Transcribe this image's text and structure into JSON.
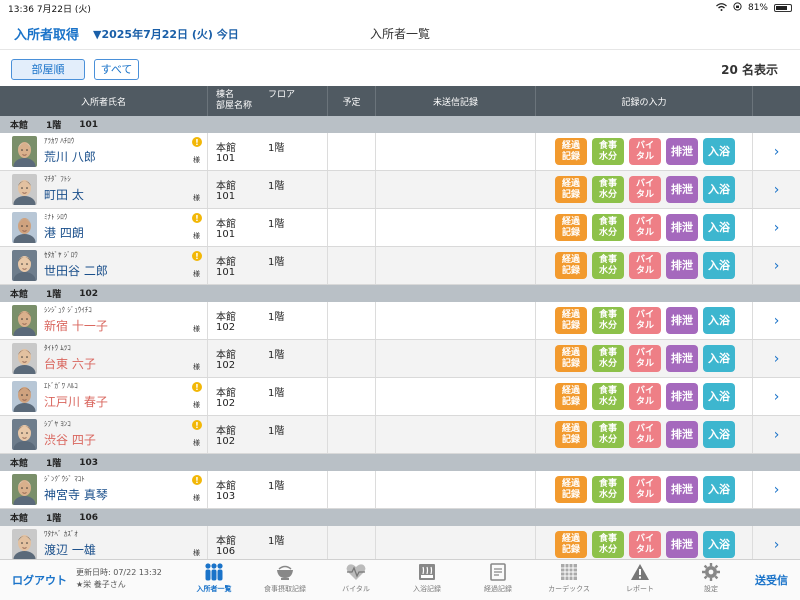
{
  "status": {
    "time": "13:36",
    "date": "7月22日 (火)",
    "battery": "81%",
    "battery_level": 0.81
  },
  "topbar": {
    "acquire": "入所者取得",
    "date": "▼2025年7月22日 (火) 今日",
    "title": "入所者一覧"
  },
  "toolbar": {
    "room_order": "部屋順",
    "all": "すべて",
    "count": "20 名表示"
  },
  "columns": {
    "name": "入所者氏名",
    "building": "棟名",
    "room": "部屋名称",
    "floor": "フロア",
    "plan": "予定",
    "unsent": "未送信記録",
    "record": "記録の入力"
  },
  "record_buttons": {
    "keika_1": "経過",
    "keika_2": "記録",
    "meal_1": "食事",
    "meal_2": "水分",
    "vital_1": "バイ",
    "vital_2": "タル",
    "excretion": "排泄",
    "bath": "入浴"
  },
  "arrow": "›",
  "groups": [
    {
      "building": "本館",
      "floor": "1階",
      "room": "101",
      "residents": [
        {
          "kana": "ｱﾗｶﾜ ﾊﾁﾛｳ",
          "name": "荒川 八郎",
          "alert": true,
          "honorific": "様",
          "female": false,
          "building": "本館",
          "floor": "1階",
          "room": "101"
        },
        {
          "kana": "ﾏﾁﾀﾞ ﾌﾄｼ",
          "name": "町田 太",
          "alert": false,
          "honorific": "様",
          "female": false,
          "building": "本館",
          "floor": "1階",
          "room": "101"
        },
        {
          "kana": "ﾐﾅﾄ ｼﾛｳ",
          "name": "港 四朗",
          "alert": true,
          "honorific": "様",
          "female": false,
          "building": "本館",
          "floor": "1階",
          "room": "101"
        },
        {
          "kana": "ｾﾀｶﾞﾔ ｼﾞﾛｳ",
          "name": "世田谷 二郎",
          "alert": true,
          "honorific": "様",
          "female": false,
          "building": "本館",
          "floor": "1階",
          "room": "101"
        }
      ]
    },
    {
      "building": "本館",
      "floor": "1階",
      "room": "102",
      "residents": [
        {
          "kana": "ｼﾝｼﾞｭｸ ｼﾞｭｳｲﾁｺ",
          "name": "新宿 十一子",
          "alert": false,
          "honorific": "様",
          "female": true,
          "building": "本館",
          "floor": "1階",
          "room": "102"
        },
        {
          "kana": "ﾀｲﾄｳ ﾑﾂｺ",
          "name": "台東 六子",
          "alert": false,
          "honorific": "様",
          "female": true,
          "building": "本館",
          "floor": "1階",
          "room": "102"
        },
        {
          "kana": "ｴﾄﾞｶﾞﾜ ﾊﾙｺ",
          "name": "江戸川 春子",
          "alert": true,
          "honorific": "様",
          "female": true,
          "building": "本館",
          "floor": "1階",
          "room": "102"
        },
        {
          "kana": "ｼﾌﾞﾔ ﾖﾝｺ",
          "name": "渋谷 四子",
          "alert": true,
          "honorific": "様",
          "female": true,
          "building": "本館",
          "floor": "1階",
          "room": "102"
        }
      ]
    },
    {
      "building": "本館",
      "floor": "1階",
      "room": "103",
      "residents": [
        {
          "kana": "ｼﾞﾝｸﾞｳｼﾞ ﾏｺﾄ",
          "name": "神宮寺 真琴",
          "alert": true,
          "honorific": "様",
          "female": false,
          "building": "本館",
          "floor": "1階",
          "room": "103"
        }
      ]
    },
    {
      "building": "本館",
      "floor": "1階",
      "room": "106",
      "residents": [
        {
          "kana": "ﾜﾀﾅﾍﾞ ｶｽﾞｵ",
          "name": "渡辺 一雄",
          "alert": false,
          "honorific": "様",
          "female": false,
          "building": "本館",
          "floor": "1階",
          "room": "106"
        }
      ]
    }
  ],
  "bottom": {
    "logout": "ログアウト",
    "updated": "更新日時: 07/22 13:32",
    "user": "★栄 養子さん",
    "send": "送受信",
    "tabs": [
      "入所者一覧",
      "食事摂取記録",
      "バイタル",
      "入浴記録",
      "経過記録",
      "カーデックス",
      "レポート",
      "設定"
    ]
  }
}
